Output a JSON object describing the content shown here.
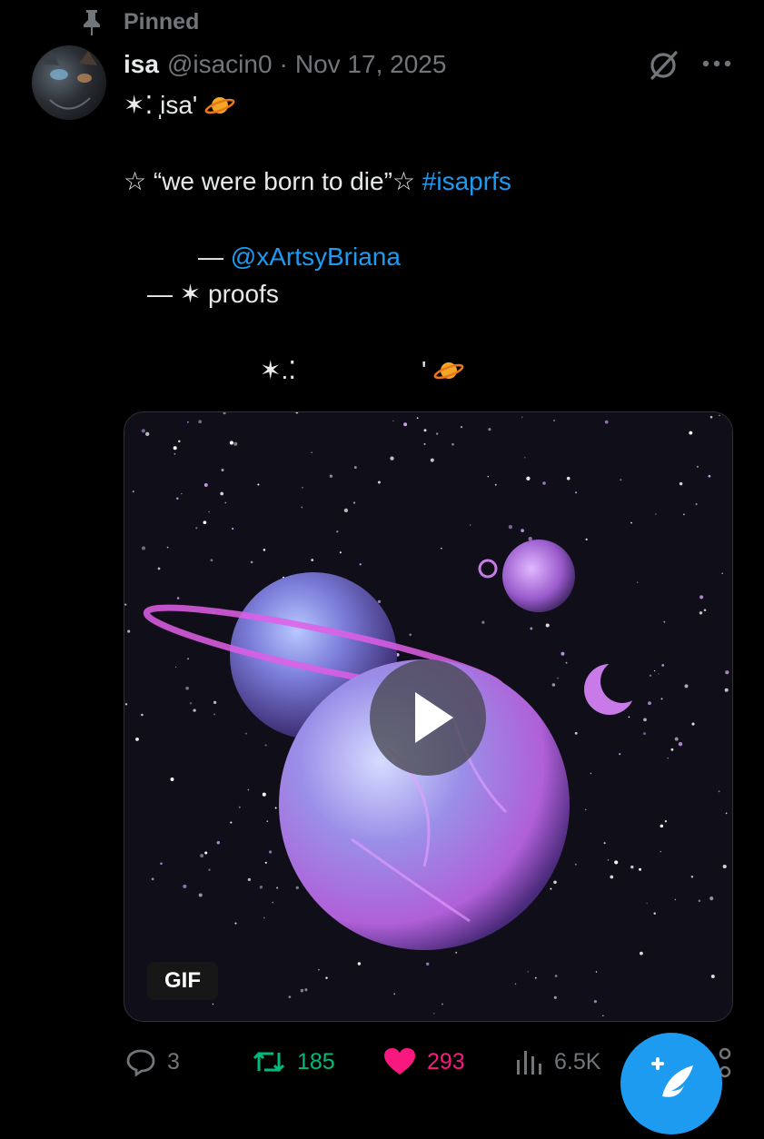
{
  "pinned": {
    "label": "Pinned",
    "icon": "pin-icon"
  },
  "author": {
    "name": "isa",
    "handle": "@isacin0",
    "separator": "·",
    "date": "Nov 17, 2025",
    "avatar": "avatar-cat"
  },
  "tweet": {
    "line1": "✶⁚ ̩isa'",
    "line2_text": "☆ “we were born to die”☆ ",
    "line2_hashtag": "#isaprfs",
    "line3_prefix": "— ",
    "line3_mention": "@xArtsyBriana",
    "line4": "— ✶ proofs",
    "line5_left": "✶.⁚",
    "line5_right": "'"
  },
  "media": {
    "badge": "GIF",
    "play_icon": "play-icon"
  },
  "actions": {
    "reply_count": "3",
    "retweet_count": "185",
    "like_count": "293",
    "views_count": "6.5K"
  },
  "colors": {
    "background": "#000000",
    "text": "#e7e9ea",
    "muted": "#71767b",
    "link": "#1d9bf0",
    "retweet": "#00ba7c",
    "like": "#f91880",
    "accent_fab": "#1d9bf0"
  }
}
